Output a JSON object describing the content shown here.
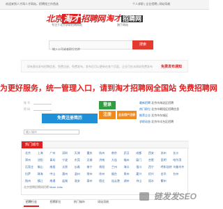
{
  "topbar": {
    "left": "欢迎来到人才网人才网站，招聘找工作首选",
    "right": "个人求职 | 企业招聘 | 网站导航"
  },
  "brand": {
    "logo_pre": "北京",
    "logo_hl": "淘才",
    "logo_post": "招聘网",
    "tagline": "专注于北京求职招聘网站",
    "side_logo": "淘才",
    "side_logo_hl": "招聘网",
    "side_sub": "旗下网站"
  },
  "search": {
    "placeholder": "输入公司或者职位名称",
    "button": "搜索"
  },
  "notice": {
    "text": "如有意向发布招聘信息，免费注册，免费发布，发布后可以更新在各个页面，企业可在本网站免费发布",
    "link": "免费发布通知"
  },
  "slogan": "为更好服务，统一管理入口，请到淘才招聘网全国站 免费招聘网",
  "login": {
    "account_label": "账 号",
    "password_label": "密 码",
    "login_button": "登录",
    "register_button": "注册",
    "biz_button": "企业用户注册",
    "free_register": "免费注册简历"
  },
  "post_area": {
    "rows": [
      {
        "label": "最新招聘",
        "text": "北京市海淀区招聘"
      },
      {
        "label": "热门职位",
        "text": "北京市朝阳区招聘信息"
      },
      {
        "label": "推荐企业",
        "text": "北京市东城区"
      },
      {
        "label": "求职动态",
        "text": "北京市丰台区招聘"
      }
    ]
  },
  "city_search": {
    "placeholder": "输入城市"
  },
  "city_box": {
    "tab": "热门城市",
    "cities": [
      "北京",
      "上海",
      "广州",
      "深圳",
      "天津",
      "重庆",
      "杭州",
      "南京",
      "武汉",
      "成都",
      "西安",
      "苏州",
      "长沙",
      "郑州",
      "沈阳",
      "青岛",
      "宁波",
      "东莞",
      "无锡",
      "济南",
      "大连",
      "福州",
      "厦门",
      "合肥",
      "昆明",
      "哈尔滨",
      "石家庄",
      "佛山",
      "南昌",
      "太原",
      "长春",
      "南宁",
      "贵阳",
      "兰州",
      "海口",
      "银川",
      "西宁",
      "呼和浩特",
      "乌鲁木齐",
      "拉萨",
      "珠海",
      "中山",
      "惠州",
      "温州",
      "常州",
      "徐州",
      "烟台",
      "泉州",
      "嘉兴",
      "绍兴",
      "金华",
      "台州",
      "扬州",
      "镇江",
      "南通",
      "盐城",
      "淮安",
      "泰州",
      "宿迁",
      "连云港",
      "湖州",
      "舟山",
      "丽水",
      "衢州"
    ]
  },
  "foot_links": {
    "text": "北京猎聘招聘网招聘",
    "blue": "More Jobs"
  },
  "foot_tabs": [
    "招聘行业",
    "招聘职位",
    "热门城市",
    "网站导航"
  ],
  "watermark": "链发发SEO"
}
